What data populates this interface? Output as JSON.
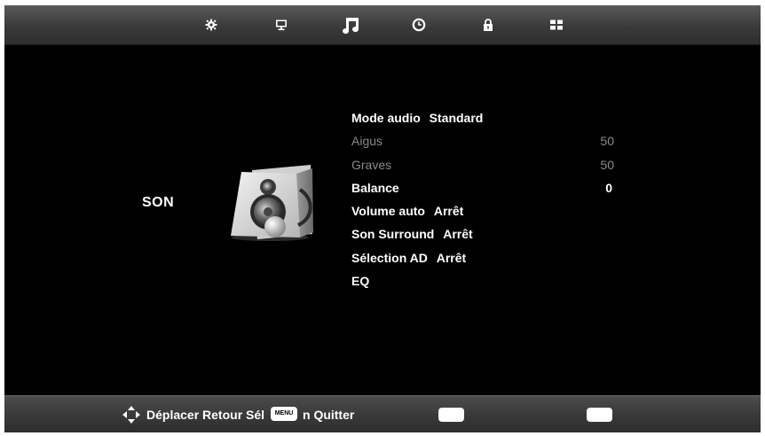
{
  "top_tabs": [
    {
      "name": "picture",
      "icon": "gear-icon"
    },
    {
      "name": "screen",
      "icon": "monitor-icon"
    },
    {
      "name": "sound",
      "icon": "music-note-icon",
      "active": true
    },
    {
      "name": "time",
      "icon": "clock-icon"
    },
    {
      "name": "lock",
      "icon": "padlock-icon"
    },
    {
      "name": "setup",
      "icon": "grid-icon"
    }
  ],
  "section": {
    "title": "SON",
    "icon": "speaker-icon"
  },
  "menu": {
    "mode_audio": {
      "label": "Mode audio",
      "value": "Standard"
    },
    "aigus": {
      "label": "Aigus",
      "value": "50"
    },
    "graves": {
      "label": "Graves",
      "value": "50"
    },
    "balance": {
      "label": "Balance",
      "value": "0"
    },
    "volume_auto": {
      "label": "Volume auto",
      "value": "Arrêt"
    },
    "son_surround": {
      "label": "Son Surround",
      "value": "Arrêt"
    },
    "selection_ad": {
      "label": "Sélection AD",
      "value": "Arrêt"
    },
    "eq": {
      "label": "EQ"
    }
  },
  "bottom": {
    "nav_icon": "four-way-arrows-icon",
    "hint_left": "Déplacer Retour Sél",
    "menu_key": "MENU",
    "hint_right": "n Quitter"
  },
  "colors": {
    "background": "#000000",
    "text": "#ffffff",
    "disabled_text": "#8a8a8a",
    "bar": "#3a3a3a"
  }
}
